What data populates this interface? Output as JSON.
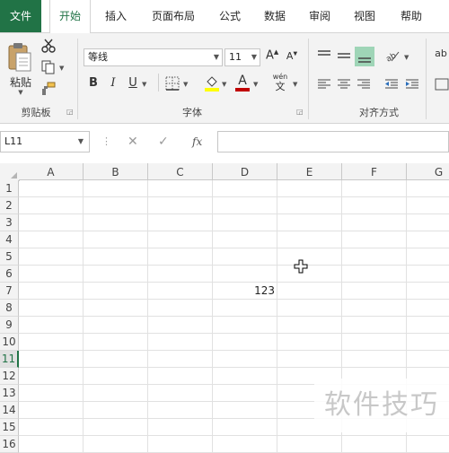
{
  "tabs": [
    "文件",
    "开始",
    "插入",
    "页面布局",
    "公式",
    "数据",
    "审阅",
    "视图",
    "帮助"
  ],
  "clipboard": {
    "paste_label": "粘贴",
    "group_label": "剪贴板"
  },
  "font": {
    "name": "等线",
    "size": "11",
    "group_label": "字体",
    "bold": "B",
    "italic": "I",
    "underline": "U",
    "font_color_glyph": "A",
    "grow_glyph": "A",
    "shrink_glyph": "A",
    "pinyin_top": "wén",
    "pinyin_bottom": "文"
  },
  "alignment": {
    "group_label": "对齐方式",
    "wrap_glyph": "ab"
  },
  "name_box": "L11",
  "fx": "fx",
  "columns": [
    "A",
    "B",
    "C",
    "D",
    "E",
    "F",
    "G"
  ],
  "rows": [
    "1",
    "2",
    "3",
    "4",
    "5",
    "6",
    "7",
    "8",
    "9",
    "10",
    "11",
    "12",
    "13",
    "14",
    "15",
    "16"
  ],
  "selected_row": "11",
  "cell_D7": "123",
  "watermark": "软件技巧",
  "colors": {
    "accent": "#217346",
    "font_color": "#c00000",
    "highlight": "#ffff00",
    "selected_align": "#9fd5b7"
  }
}
